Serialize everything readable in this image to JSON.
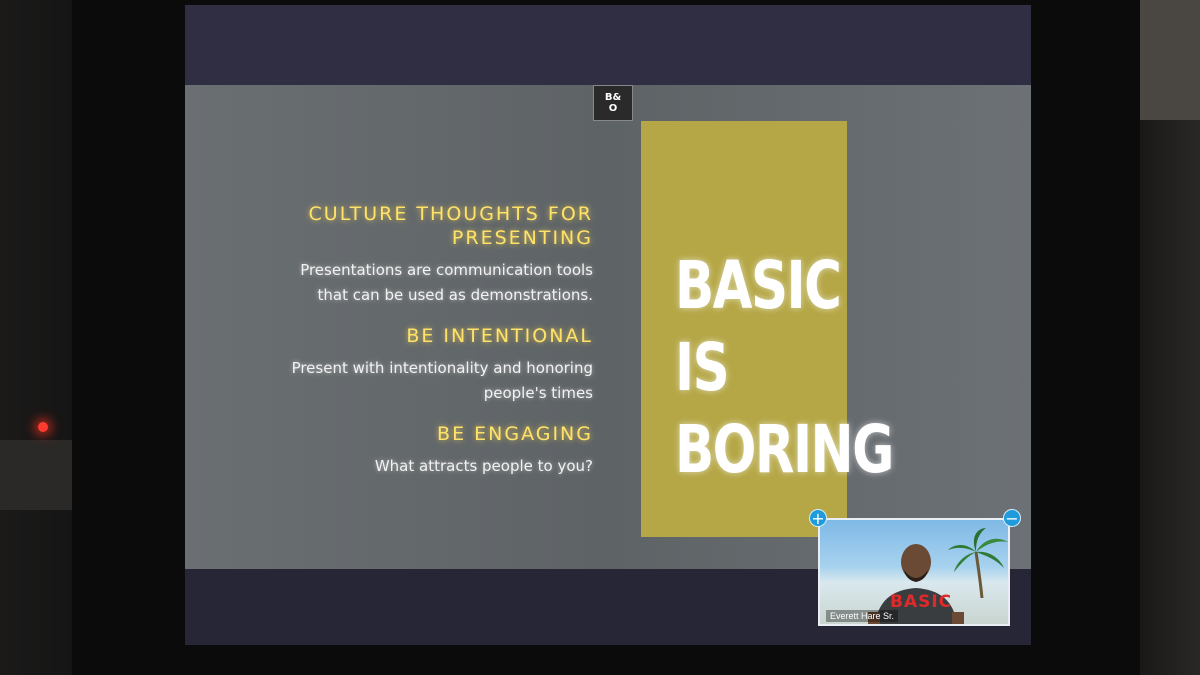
{
  "slide": {
    "logo_line1": "B&",
    "logo_line2": "O",
    "headings": [
      "CULTURE THOUGHTS FOR",
      "PRESENTING",
      "BE INTENTIONAL",
      "BE ENGAGING"
    ],
    "bodies": [
      "Presentations are communication tools",
      "that can be used as demonstrations.",
      "Present with intentionality and honoring",
      "people's times",
      "What attracts people to you?"
    ],
    "big_text": [
      "BASIC IS",
      "BORING"
    ]
  },
  "video": {
    "participant_name": "Everett Hare Sr.",
    "shirt_text": "BASIC",
    "add_symbol": "+",
    "remove_symbol": "−"
  },
  "colors": {
    "heading": "#ffe26a",
    "gold_panel": "#b5a746",
    "video_button": "#1f9bdc"
  }
}
